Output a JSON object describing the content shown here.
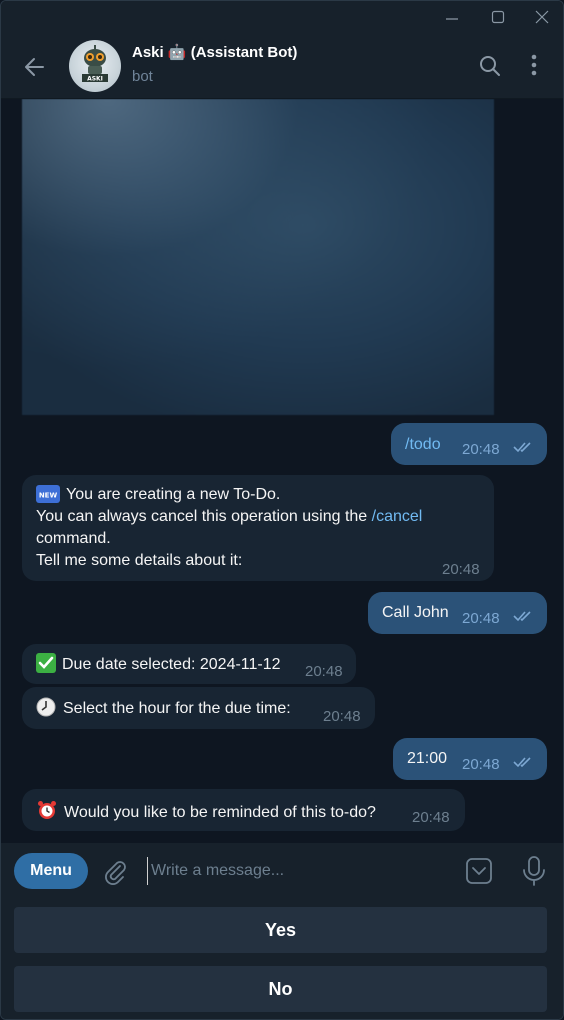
{
  "header": {
    "title": "Aski 🤖 (Assistant Bot)",
    "subtitle": "bot",
    "avatar_text": "ASKI"
  },
  "messages": [
    {
      "dir": "out",
      "text": "/todo",
      "time": "20:48"
    },
    {
      "dir": "in",
      "emoji": "NEW",
      "lines": [
        "You are creating a new To-Do.",
        "You can always cancel this operation using the ",
        "/cancel",
        " command.",
        "Tell me some details about it:"
      ],
      "time": "20:48"
    },
    {
      "dir": "out",
      "text": "Call John",
      "time": "20:48"
    },
    {
      "dir": "in",
      "emoji": "check-mark",
      "text": "Due date selected: 2024-11-12",
      "time": "20:48"
    },
    {
      "dir": "in",
      "emoji": "clock",
      "text": "Select the hour for the due time:",
      "time": "20:48"
    },
    {
      "dir": "out",
      "text": "21:00",
      "time": "20:48"
    },
    {
      "dir": "in",
      "emoji": "alarm-clock",
      "text": "Would you like to be reminded of this to-do?",
      "time": "20:48"
    }
  ],
  "input": {
    "menu_label": "Menu",
    "placeholder": "Write a message..."
  },
  "keyboard": {
    "buttons": [
      "Yes",
      "No"
    ]
  },
  "colors": {
    "background": "#0e1621",
    "incoming_bubble": "#182533",
    "outgoing_bubble": "#2b5278",
    "link": "#71baf2",
    "menu_button": "#2f6ea5"
  }
}
